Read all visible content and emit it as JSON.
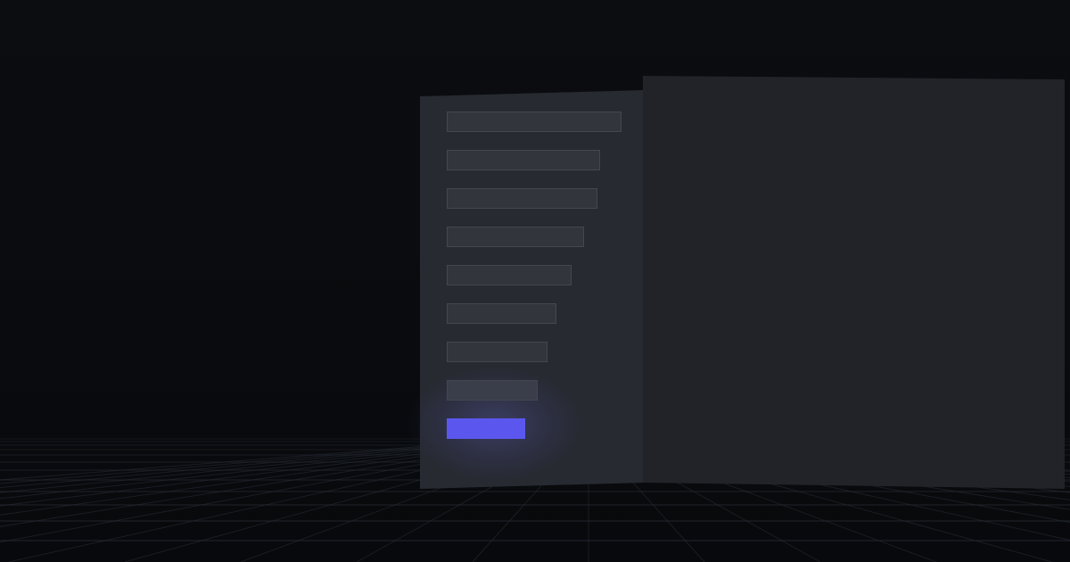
{
  "theme": {
    "background": "#0a0c10",
    "sidebar_panel": "#272a31",
    "content_panel": "#212328",
    "menu_item_fill": "#32353c",
    "menu_item_border": "#44474e",
    "accent": "#5b57ee",
    "grid_line": "#2a2e36"
  },
  "sidebar": {
    "items": [
      {
        "label": ""
      },
      {
        "label": ""
      },
      {
        "label": ""
      },
      {
        "label": ""
      },
      {
        "label": ""
      },
      {
        "label": ""
      },
      {
        "label": ""
      },
      {
        "label": ""
      }
    ],
    "primary_button": {
      "label": ""
    }
  },
  "content": {
    "title": ""
  }
}
